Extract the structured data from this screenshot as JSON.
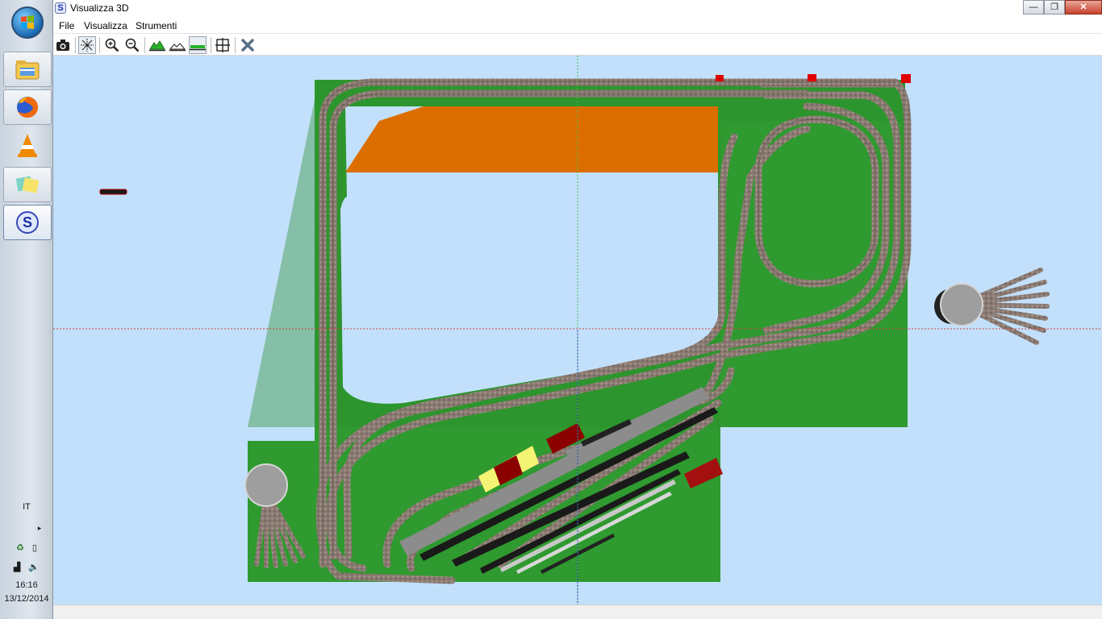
{
  "window": {
    "title": "Visualizza 3D",
    "app_icon_letter": "S",
    "minimize_label": "—",
    "restore_label": "❐",
    "close_label": "✕"
  },
  "menu": {
    "items": [
      "File",
      "Visualizza",
      "Strumenti"
    ]
  },
  "toolbar": {
    "tools": [
      "camera-icon",
      "axes-toggle-icon",
      "zoom-in-icon",
      "zoom-out-icon",
      "terrain-high-icon",
      "terrain-low-icon",
      "terrain-flat-icon",
      "fit-view-icon",
      "close-view-icon"
    ],
    "active_tool": "terrain-flat-icon"
  },
  "taskbar": {
    "language": "IT",
    "time": "16:16",
    "date": "13/12/2014",
    "pinned": [
      "file-explorer-icon",
      "firefox-icon",
      "vlc-icon",
      "image-viewer-icon",
      "s-app-icon"
    ]
  },
  "colors": {
    "sky": "#c2e0fb",
    "baseboard": "#2f9a2f",
    "raised_area": "#dc6e00",
    "track": "#8a7a72",
    "platform": "#8c8c8c",
    "marker": "#e00000",
    "axis_green": "#48c048",
    "axis_blue": "#3040d0",
    "axis_red": "#d04040"
  }
}
